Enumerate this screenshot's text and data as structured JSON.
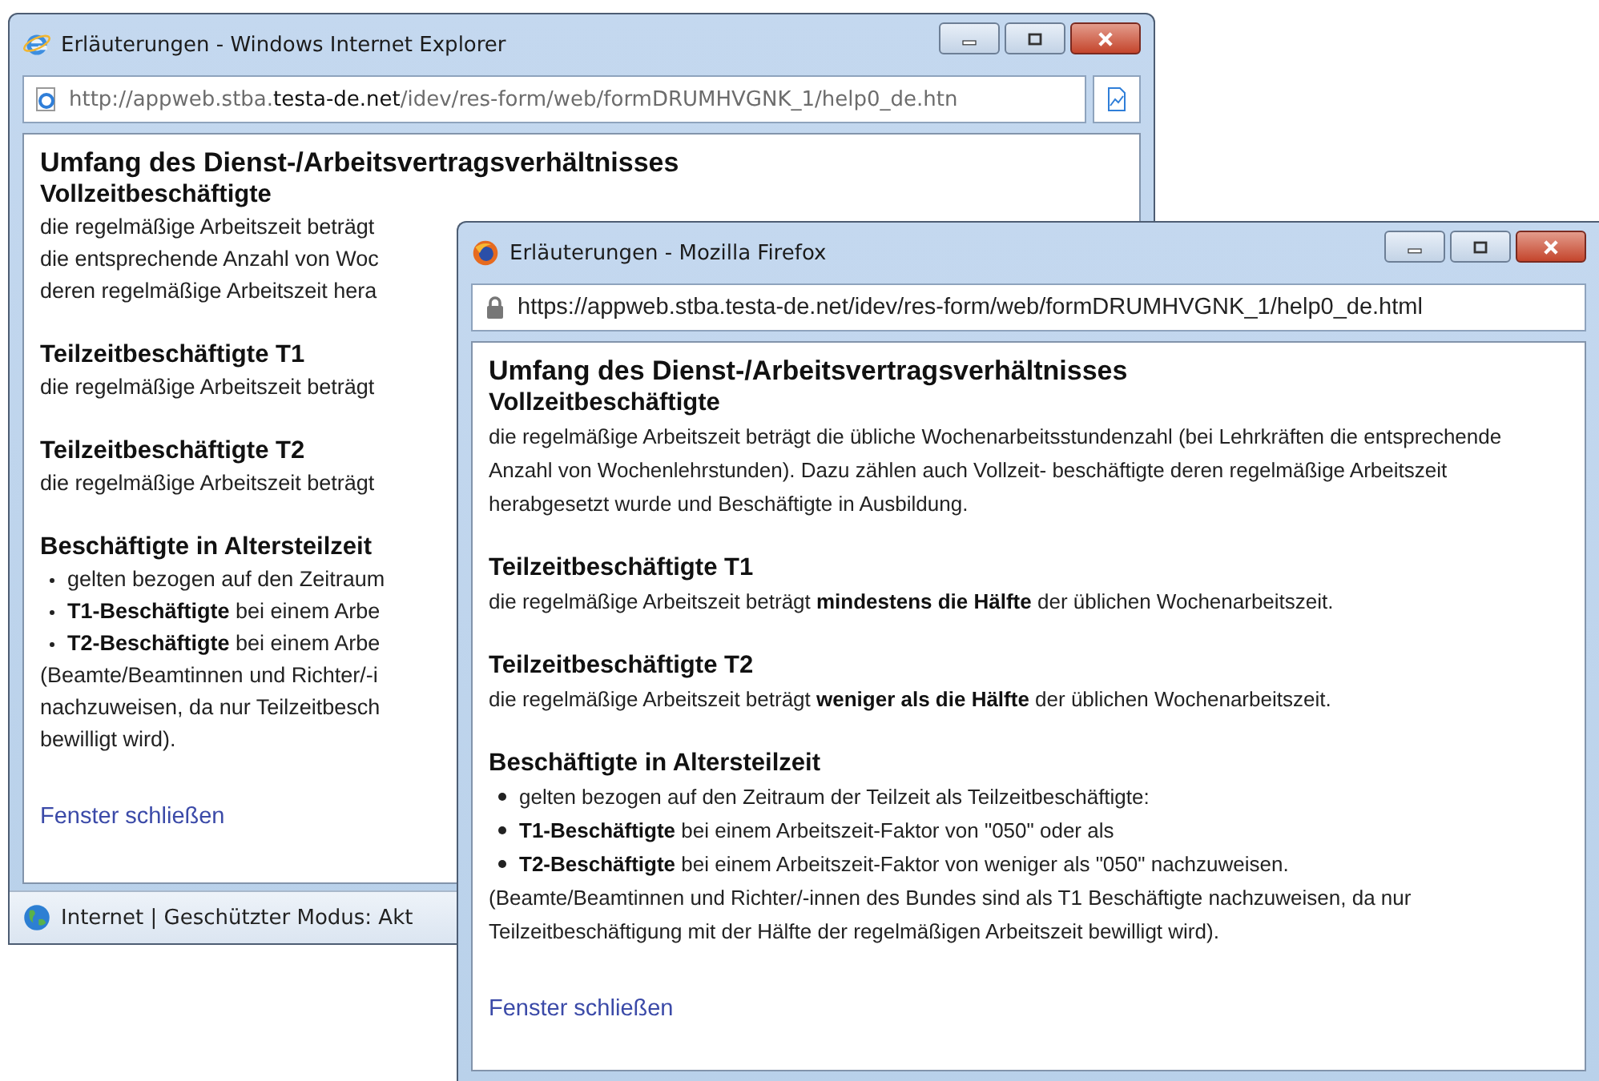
{
  "windows": [
    {
      "kind": "ie",
      "title": "Erläuterungen - Windows Internet Explorer",
      "address": "http://appweb.stba.**testa-de.net**/idev/res-form/web/formDRUMHVGNK_1/help0_de.htn",
      "page": {
        "title": "Umfang des Dienst-/Arbeitsvertragsverhältnisses",
        "sections": [
          {
            "heading": "Vollzeitbeschäftigte",
            "lines": [
              "die regelmäßige Arbeitszeit beträgt",
              "die entsprechende Anzahl von Woc",
              "deren regelmäßige Arbeitszeit hera"
            ]
          },
          {
            "heading": "Teilzeitbeschäftigte T1",
            "lines": [
              "die regelmäßige Arbeitszeit beträgt"
            ]
          },
          {
            "heading": "Teilzeitbeschäftigte T2",
            "lines": [
              "die regelmäßige Arbeitszeit beträgt"
            ]
          },
          {
            "heading": "Beschäftigte in Altersteilzeit",
            "bullets": [
              "gelten bezogen auf den Zeitraum",
              "**T1-Beschäftigte** bei einem Arbe",
              "**T2-Beschäftigte** bei einem Arbe"
            ],
            "notes": [
              "(Beamte/Beamtinnen und Richter/-i",
              "nachzuweisen, da nur Teilzeitbesch",
              "bewilligt wird)."
            ]
          }
        ],
        "link": "Fenster schließen"
      },
      "status": "Internet | Geschützter Modus: Akt"
    },
    {
      "kind": "firefox",
      "title": "Erläuterungen - Mozilla Firefox",
      "address": "https://appweb.stba.testa-de.net/idev/res-form/web/formDRUMHVGNK_1/help0_de.html",
      "page": {
        "title": "Umfang des Dienst-/Arbeitsvertragsverhältnisses",
        "sections": [
          {
            "heading": "Vollzeitbeschäftigte",
            "lines": [
              "die regelmäßige Arbeitszeit beträgt die übliche Wochenarbeitsstundenzahl (bei Lehrkräften die entsprechende Anzahl von Wochenlehrstunden). Dazu zählen auch Vollzeit- beschäftigte deren regelmäßige Arbeitszeit herabgesetzt wurde und Beschäftigte in Ausbildung."
            ]
          },
          {
            "heading": "Teilzeitbeschäftigte T1",
            "lines": [
              "die regelmäßige Arbeitszeit beträgt **mindestens die Hälfte** der üblichen Wochenarbeitszeit."
            ]
          },
          {
            "heading": "Teilzeitbeschäftigte T2",
            "lines": [
              "die regelmäßige Arbeitszeit beträgt **weniger als die Hälfte** der üblichen Wochenarbeitszeit."
            ]
          },
          {
            "heading": "Beschäftigte in Altersteilzeit",
            "bullets": [
              "gelten bezogen auf den Zeitraum der Teilzeit als Teilzeitbeschäftigte:",
              "**T1-Beschäftigte** bei einem Arbeitszeit-Faktor von \"050\" oder als",
              "**T2-Beschäftigte** bei einem Arbeitszeit-Faktor von weniger als \"050\" nachzuweisen."
            ],
            "notes": [
              "(Beamte/Beamtinnen und Richter/-innen des Bundes sind als T1 Beschäftigte nachzuweisen, da nur Teilzeitbeschäftigung mit der Hälfte der regelmäßigen Arbeitszeit bewilligt wird)."
            ]
          }
        ],
        "link": "Fenster schließen"
      }
    }
  ]
}
